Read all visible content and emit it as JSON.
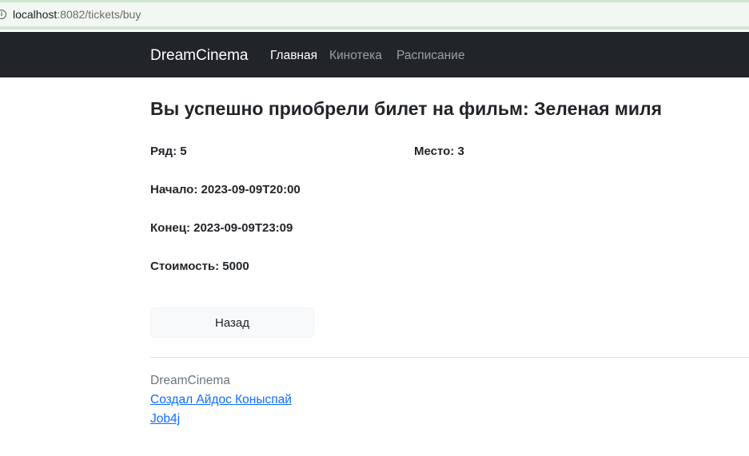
{
  "browser": {
    "url_host": "localhost",
    "url_rest": ":8082/tickets/buy"
  },
  "navbar": {
    "brand": "DreamCinema",
    "links": [
      {
        "label": "Главная",
        "active": true
      },
      {
        "label": "Кинотека",
        "active": false
      },
      {
        "label": "Расписание",
        "active": false
      }
    ]
  },
  "main": {
    "title": "Вы успешно приобрели билет на фильм: Зеленая миля",
    "row": "Ряд: 5",
    "seat": "Место: 3",
    "start": "Начало: 2023-09-09T20:00",
    "end": "Конец: 2023-09-09T23:09",
    "price": "Стоимость: 5000",
    "back_label": "Назад"
  },
  "footer": {
    "brand": "DreamCinema",
    "author_link": "Создал Айдос Коныспай",
    "job_link": "Job4j"
  },
  "colors": {
    "navbar_bg": "#212529",
    "link": "#0d6efd",
    "button_bg": "#f8f9fa"
  }
}
